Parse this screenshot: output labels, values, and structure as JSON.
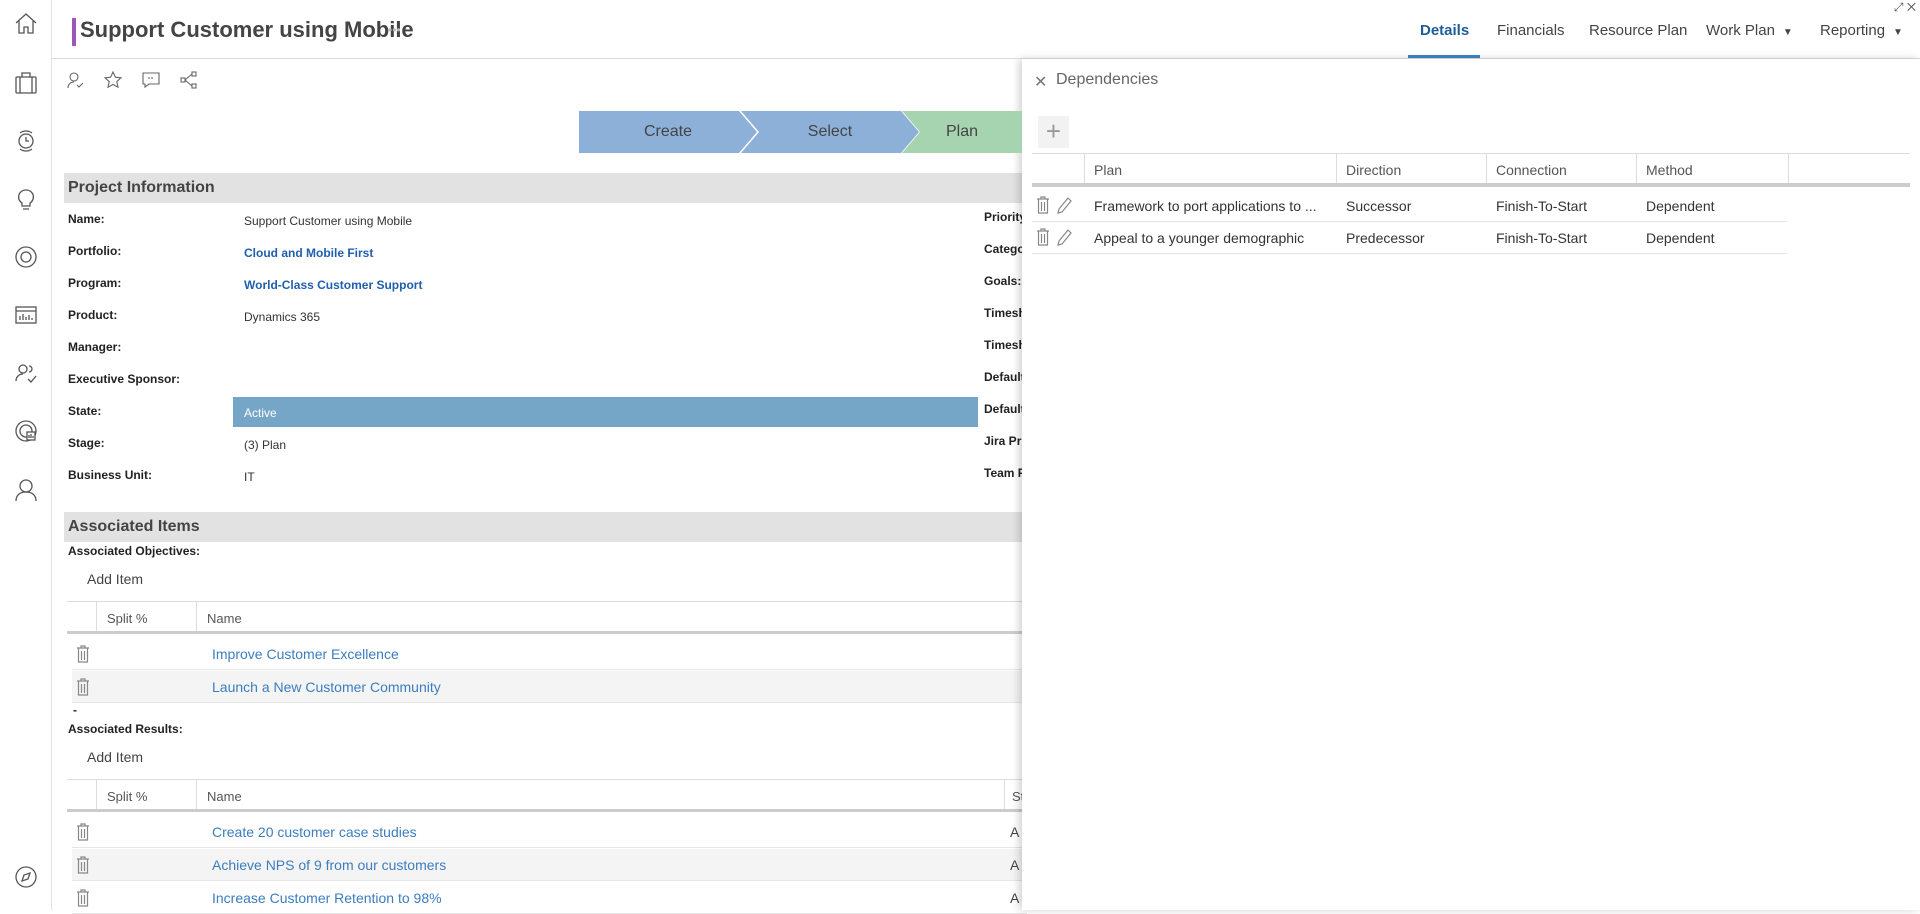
{
  "window_controls": {
    "expand": "⤢",
    "close": "✕"
  },
  "sidebar": {
    "items": [
      "home-icon",
      "briefcase-icon",
      "timesheet-icon",
      "idea-icon",
      "target-icon",
      "report-icon",
      "resource-icon",
      "dashboard-icon",
      "user-icon",
      "compass-icon"
    ]
  },
  "header": {
    "title": "Support Customer using Mobile",
    "more": "•••",
    "tabs": [
      {
        "label": "Details",
        "active": true
      },
      {
        "label": "Financials"
      },
      {
        "label": "Resource Plan"
      },
      {
        "label": "Work Plan",
        "dropdown": true
      },
      {
        "label": "Reporting",
        "dropdown": true
      }
    ],
    "dropdown_glyph": "▼"
  },
  "toolbar": [
    "assign-user-icon",
    "star-icon",
    "comment-icon",
    "share-icon"
  ],
  "stages": [
    {
      "label": "Create",
      "color": "#8db0d8"
    },
    {
      "label": "Select",
      "color": "#8db0d8"
    },
    {
      "label": "Plan",
      "color": "#a6d4b1"
    }
  ],
  "project_info": {
    "title": "Project Information",
    "fields": [
      {
        "label": "Name:",
        "value": "Support Customer using Mobile"
      },
      {
        "label": "Portfolio:",
        "value": "Cloud and Mobile First",
        "link": true
      },
      {
        "label": "Program:",
        "value": "World-Class Customer Support",
        "link": true
      },
      {
        "label": "Product:",
        "value": "Dynamics 365"
      },
      {
        "label": "Manager:",
        "value": ""
      },
      {
        "label": "Executive Sponsor:",
        "value": ""
      },
      {
        "label": "State:",
        "value": "Active"
      },
      {
        "label": "Stage:",
        "value": "(3) Plan"
      },
      {
        "label": "Business Unit:",
        "value": "IT"
      }
    ],
    "right_labels": [
      "Priority",
      "Category",
      "Goals:",
      "Timesheet",
      "Timesheet",
      "Default",
      "Default",
      "Jira Pr",
      "Team F"
    ]
  },
  "associated": {
    "title": "Associated Items",
    "objectives": {
      "label": "Associated Objectives:",
      "add": "Add Item",
      "columns": [
        "Split %",
        "Name"
      ],
      "rows": [
        "Improve Customer Excellence",
        "Launch a New Customer Community"
      ]
    },
    "separator": "-",
    "results": {
      "label": "Associated Results:",
      "add": "Add Item",
      "columns": [
        "Split %",
        "Name",
        "Sta"
      ],
      "rows": [
        {
          "name": "Create 20 customer case studies",
          "status": "A"
        },
        {
          "name": "Achieve NPS of 9 from our customers",
          "status": "A"
        },
        {
          "name": "Increase Customer Retention to 98%",
          "status": "A"
        }
      ]
    }
  },
  "dependencies": {
    "title": "Dependencies",
    "close": "✕",
    "add": "+",
    "columns": [
      "Plan",
      "Direction",
      "Connection",
      "Method"
    ],
    "rows": [
      {
        "plan": "Framework to port applications to ...",
        "direction": "Successor",
        "connection": "Finish-To-Start",
        "method": "Dependent"
      },
      {
        "plan": "Appeal to a younger demographic",
        "direction": "Predecessor",
        "connection": "Finish-To-Start",
        "method": "Dependent"
      }
    ]
  }
}
